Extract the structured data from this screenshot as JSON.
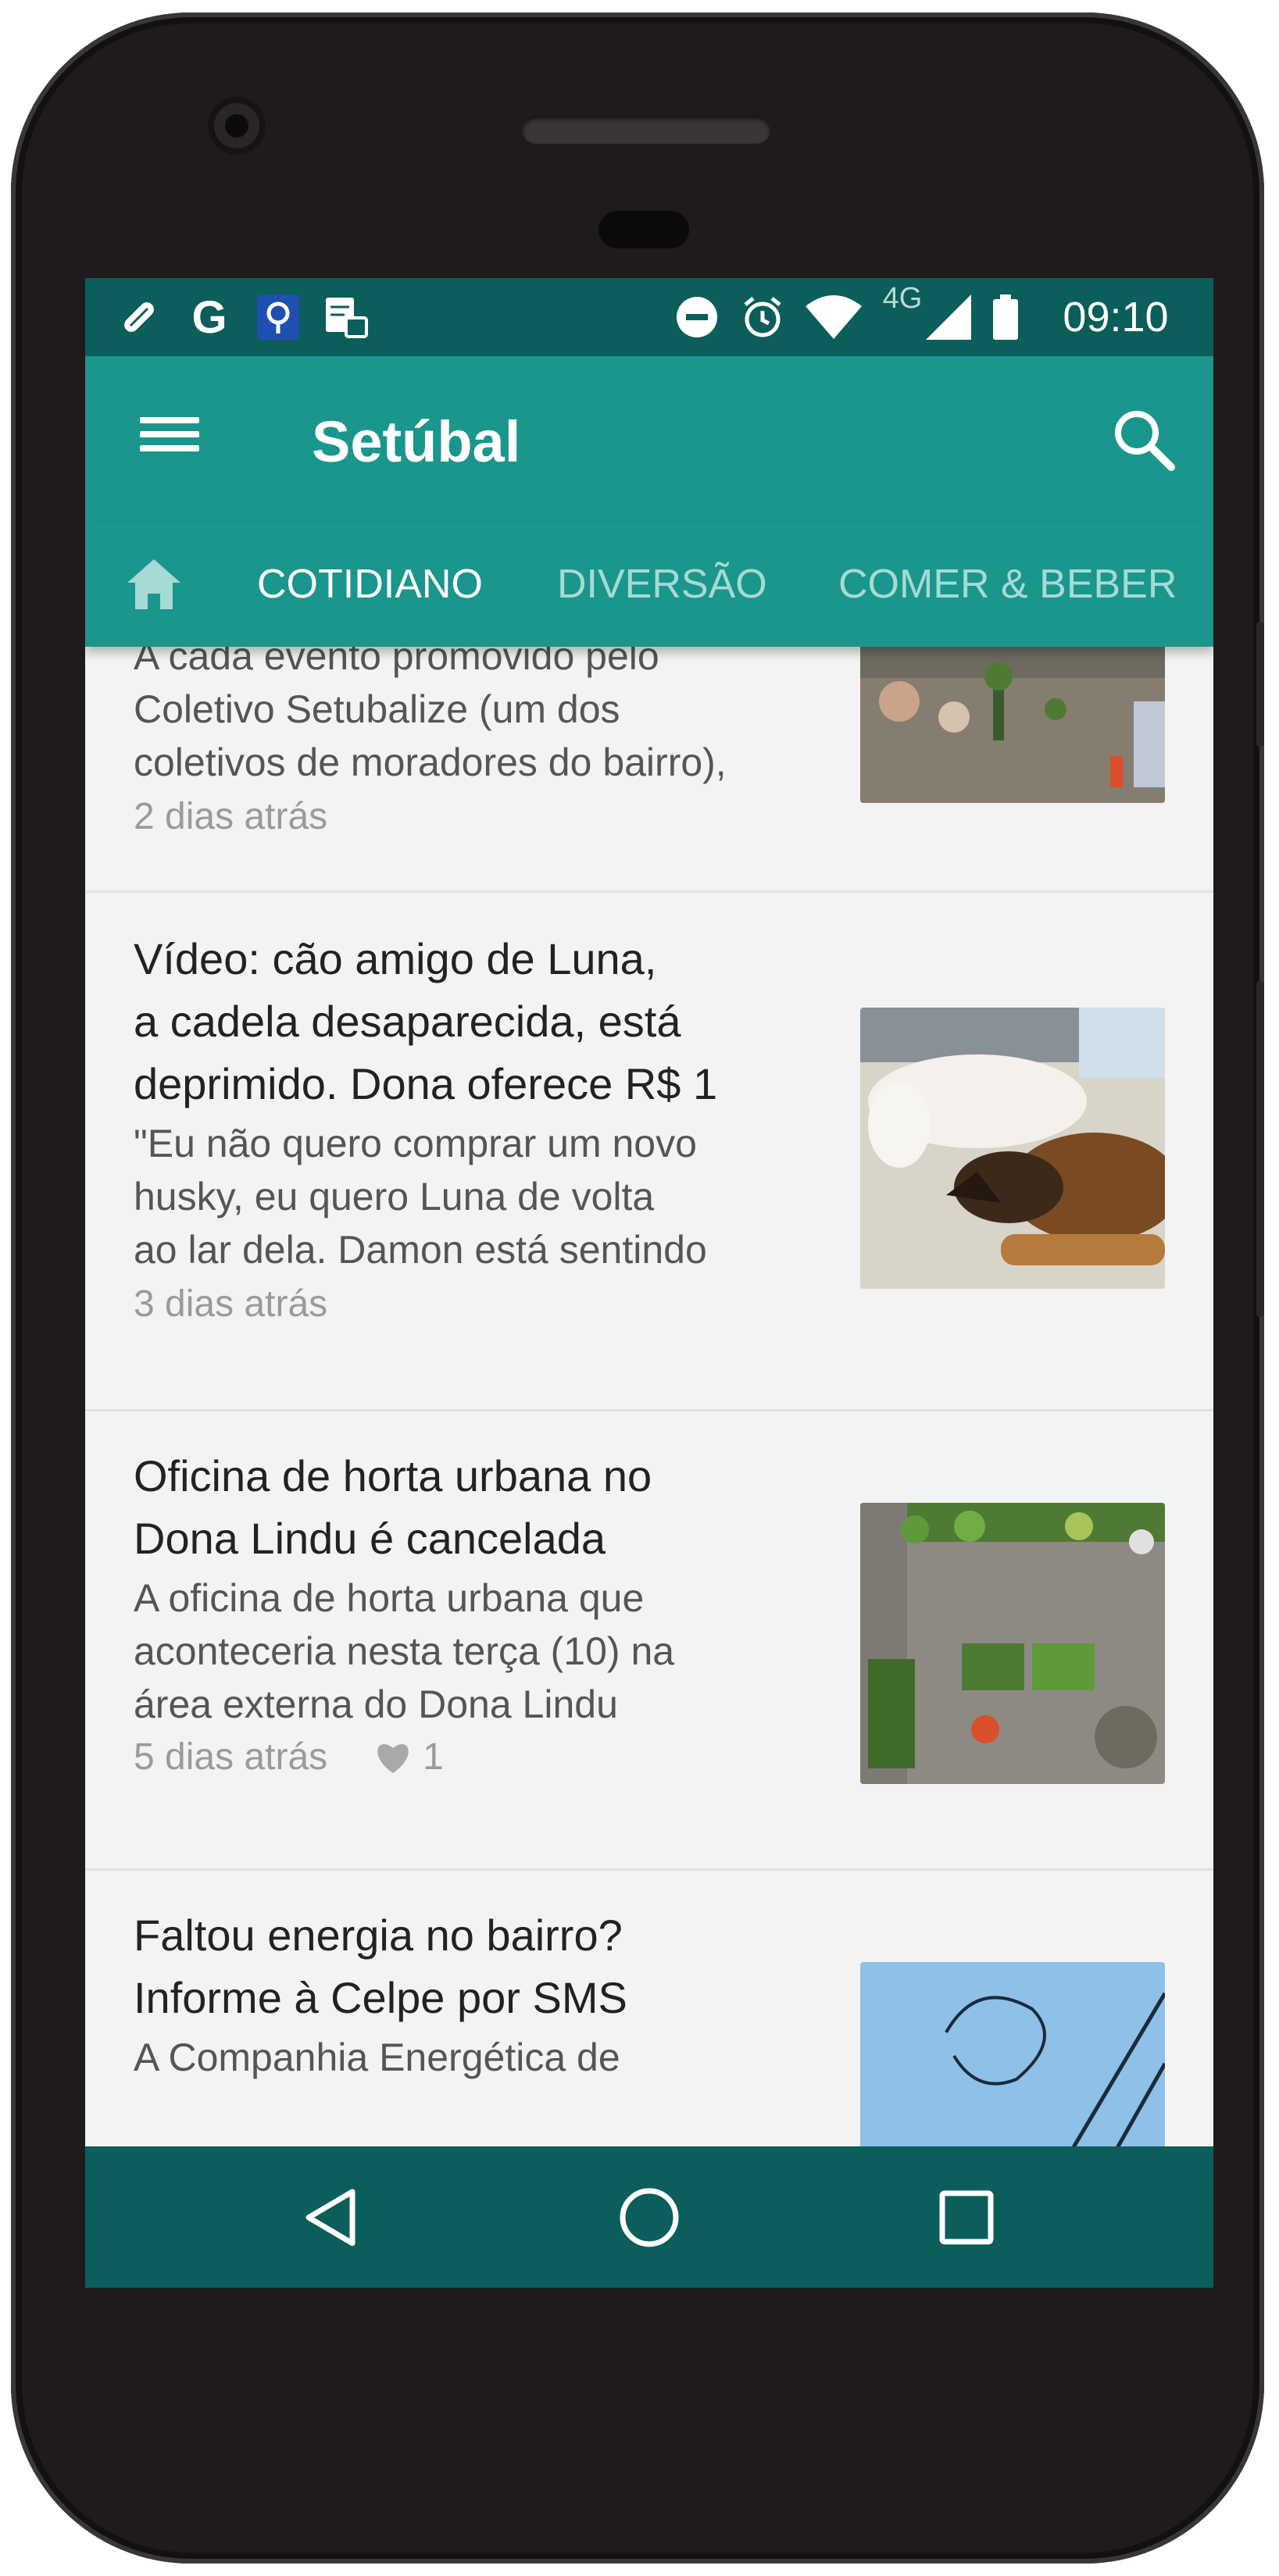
{
  "status_bar": {
    "left_icons": [
      "tool-icon",
      "google-icon",
      "maps-icon",
      "sim-icon"
    ],
    "google_glyph": "G",
    "right_icons": [
      "do-not-disturb-icon",
      "alarm-icon",
      "wifi-icon",
      "signal-icon",
      "battery-icon"
    ],
    "network": "4G",
    "time": "09:10"
  },
  "app_bar": {
    "title": "Setúbal",
    "menu_icon": "hamburger-menu-icon",
    "search_icon": "search-icon"
  },
  "tabs": [
    {
      "label": "COTIDIANO",
      "active": true
    },
    {
      "label": "DIVERSÃO",
      "active": false
    },
    {
      "label": "COMER & BEBER",
      "active": false
    }
  ],
  "home_tab_icon": "home-icon",
  "articles": [
    {
      "title": "",
      "excerpt": [
        "A cada evento promovido pelo",
        "Coletivo Setubalize (um dos",
        "coletivos de moradores do bairro),"
      ],
      "time": "2 dias atrás",
      "likes": "",
      "thumbnail": "people-planting-photo"
    },
    {
      "title": [
        "Vídeo: cão amigo de Luna,",
        "a cadela desaparecida, está",
        "deprimido. Dona oferece R$ 1"
      ],
      "excerpt": [
        "\"Eu não quero comprar um novo",
        "husky, eu quero Luna de volta",
        "ao lar dela. Damon está sentindo"
      ],
      "time": "3 dias atrás",
      "likes": "",
      "thumbnail": "dogs-photo"
    },
    {
      "title": [
        "Oficina de horta urbana no",
        "Dona Lindu é cancelada"
      ],
      "excerpt": [
        "A oficina de horta urbana que",
        "aconteceria nesta terça (10) na",
        "área externa do Dona Lindu"
      ],
      "time": "5 dias atrás",
      "likes": "1",
      "thumbnail": "urban-garden-photo"
    },
    {
      "title": [
        "Faltou energia no bairro?",
        "Informe à Celpe por SMS"
      ],
      "excerpt": [
        "A Companhia Energética de"
      ],
      "time": "",
      "likes": "",
      "thumbnail": "power-lines-photo"
    }
  ],
  "nav_bar": {
    "buttons": [
      "back-icon",
      "home-circle-icon",
      "recents-icon"
    ]
  },
  "colors": {
    "primary": "#1a968c",
    "primary_dark": "#0b5e5a",
    "tab_inactive": "#a6dad5",
    "background": "#f3f3f3"
  }
}
